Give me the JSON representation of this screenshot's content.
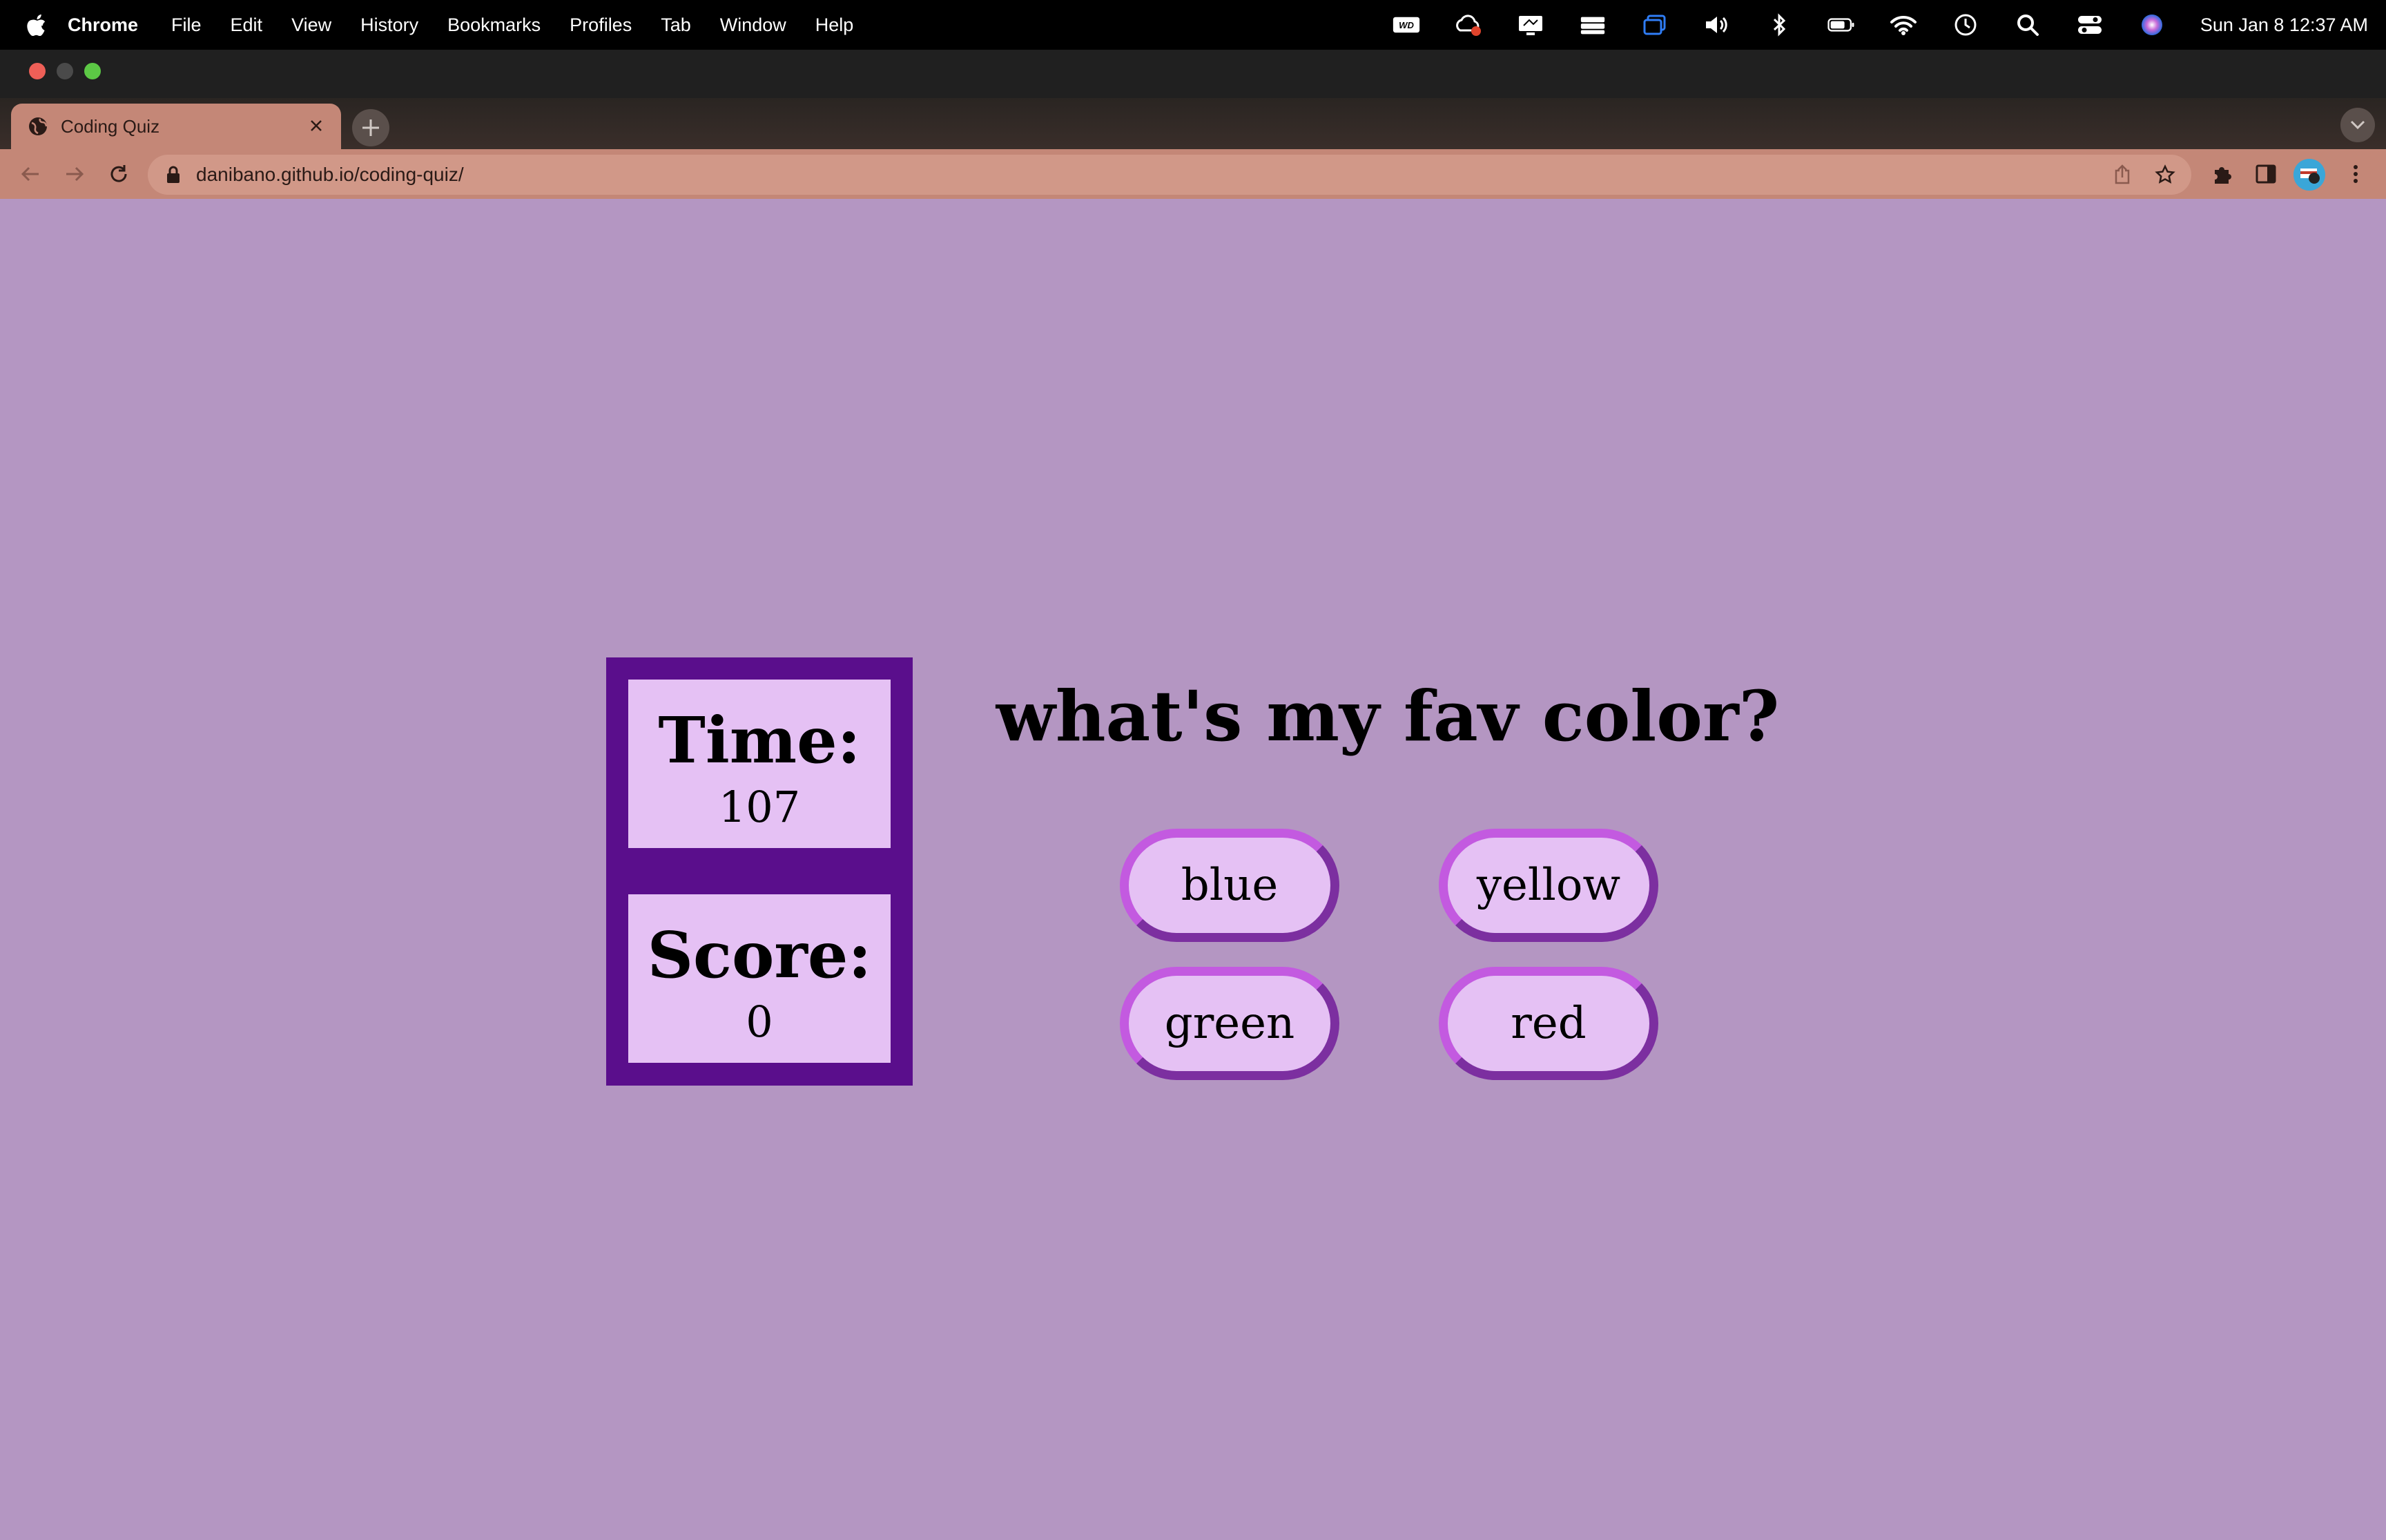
{
  "menubar": {
    "app": "Chrome",
    "items": [
      "File",
      "Edit",
      "View",
      "History",
      "Bookmarks",
      "Profiles",
      "Tab",
      "Window",
      "Help"
    ],
    "clock": "Sun Jan 8  12:37 AM",
    "status_icons": [
      "wd-icon",
      "cloud-sync-icon",
      "display-icon",
      "stack-icon",
      "window-icon",
      "volume-icon",
      "bluetooth-icon",
      "battery-icon",
      "wifi-icon",
      "time-machine-icon",
      "spotlight-icon",
      "control-center-icon",
      "siri-icon"
    ]
  },
  "browser": {
    "tab_title": "Coding Quiz",
    "url": "danibano.github.io/coding-quiz/"
  },
  "quiz": {
    "time_label": "Time:",
    "time_value": "107",
    "score_label": "Score:",
    "score_value": "0",
    "question": "what's my fav color?",
    "answers": [
      "blue",
      "yellow",
      "green",
      "red"
    ]
  },
  "colors": {
    "page_background": "#b496c2",
    "sidebar": "#5a0e8c",
    "panel": "#e5c1f4",
    "button_border_dark": "#7c2fa0",
    "button_border_light": "#c35ae0",
    "tab_accent": "#c48777"
  }
}
